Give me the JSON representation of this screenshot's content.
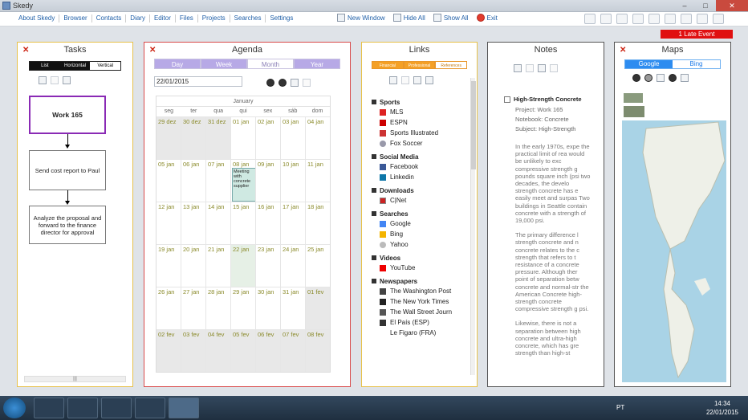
{
  "window": {
    "title": "Skedy",
    "min": "–",
    "max": "□",
    "close": "✕"
  },
  "menu": {
    "items": [
      "About Skedy",
      "Browser",
      "Contacts",
      "Diary",
      "Editor",
      "Files",
      "Projects",
      "Searches",
      "Settings"
    ],
    "new_window": "New Window",
    "hide_all": "Hide All",
    "show_all": "Show All",
    "exit": "Exit"
  },
  "late_event": "1 Late Event",
  "tasks": {
    "title": "Tasks",
    "close": "✕",
    "layout_options": [
      "List",
      "Horizontal",
      "Vertical"
    ],
    "items": [
      "Work 165",
      "Send cost report to Paul",
      "Analyze the proposal and forward to the finance director for approval"
    ],
    "scroll_grip": "|||"
  },
  "agenda": {
    "title": "Agenda",
    "close": "✕",
    "views": [
      "Day",
      "Week",
      "Month",
      "Year"
    ],
    "active_view": "Month",
    "date": "22/01/2015",
    "month": "January",
    "weekdays": [
      "seg",
      "ter",
      "qua",
      "qui",
      "sex",
      "sáb",
      "dom"
    ],
    "weeks": [
      [
        "29 dez",
        "30 dez",
        "31 dez",
        "01 jan",
        "02 jan",
        "03 jan",
        "04 jan"
      ],
      [
        "05 jan",
        "06 jan",
        "07 jan",
        "08 jan",
        "09 jan",
        "10 jan",
        "11 jan"
      ],
      [
        "12 jan",
        "13 jan",
        "14 jan",
        "15 jan",
        "16 jan",
        "17 jan",
        "18 jan"
      ],
      [
        "19 jan",
        "20 jan",
        "21 jan",
        "22 jan",
        "23 jan",
        "24 jan",
        "25 jan"
      ],
      [
        "26 jan",
        "27 jan",
        "28 jan",
        "29 jan",
        "30 jan",
        "31 jan",
        "01 fev"
      ],
      [
        "02 fev",
        "03 fev",
        "04 fev",
        "05 fev",
        "06 fev",
        "07 fev",
        "08 fev"
      ]
    ],
    "event": "Meeting with concrete supplier"
  },
  "links": {
    "title": "Links",
    "close": "✕",
    "tabs": [
      "Financial",
      "Professional",
      "References"
    ],
    "groups": [
      {
        "name": "Sports",
        "items": [
          "MLS",
          "ESPN",
          "Sports Illustrated",
          "Fox Soccer"
        ]
      },
      {
        "name": "Social Media",
        "items": [
          "Facebook",
          "Linkedin"
        ]
      },
      {
        "name": "Downloads",
        "items": [
          "C|Net"
        ]
      },
      {
        "name": "Searches",
        "items": [
          "Google",
          "Bing",
          "Yahoo"
        ]
      },
      {
        "name": "Videos",
        "items": [
          "YouTube"
        ]
      },
      {
        "name": "Newspapers",
        "items": [
          "The Washington Post",
          "The New York Times",
          "The Wall Street Journ",
          "El País (ESP)",
          "Le Figaro (FRA)"
        ]
      }
    ]
  },
  "notes": {
    "title": "Notes",
    "note_title": "High-Strength Concrete",
    "project": "Project: Work 165",
    "notebook": "Notebook: Concrete",
    "subject": "Subject: High-Strength",
    "paragraphs": [
      "In the early 1970s, expe the practical limit of rea would be unlikely to exc compressive strength g pounds square inch (psi two decades, the develo strength concrete has e easily meet and surpas Two buildings in Seattle contain concrete with a strength of 19,000 psi.",
      "The primary difference l strength concrete and n concrete relates to the c strength that refers to t resistance of a concrete pressure. Although ther point of separation betw concrete and normal-str the American Concrete high-strength concrete compressive strength g psi.",
      "Likewise, there is not a separation between high concrete and ultra-high concrete, which has gre strength than high-st"
    ]
  },
  "maps": {
    "title": "Maps",
    "close": "✕",
    "tabs": [
      "Google",
      "Bing"
    ]
  },
  "taskbar": {
    "lang": "PT",
    "time": "14:34",
    "date": "22/01/2015"
  }
}
